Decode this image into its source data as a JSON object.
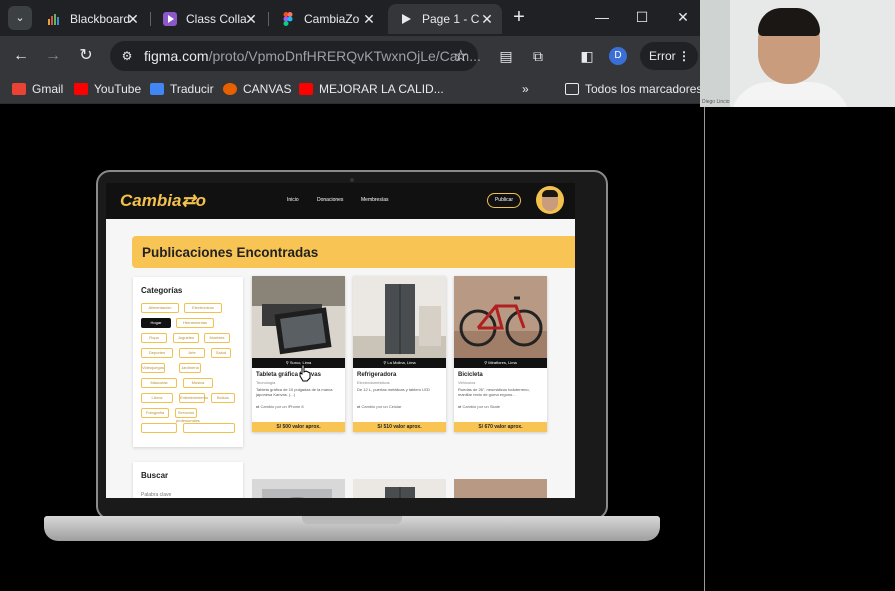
{
  "browser": {
    "tabs": [
      {
        "title": "Blackboard",
        "color": "#e8a33c"
      },
      {
        "title": "Class Colla",
        "color": "#8a58c8"
      },
      {
        "title": "CambiaZo",
        "color": "#f24e1e"
      },
      {
        "title": "Page 1 - C",
        "color": "#e8eaed"
      }
    ],
    "url_host": "figma.com",
    "url_path": "/proto/VpmoDnfHRERQvKTwxnOjLe/Cam...",
    "error_label": "Error",
    "profile_initial": "D",
    "bookmarks": [
      {
        "label": "Gmail",
        "color": "#ea4335"
      },
      {
        "label": "YouTube",
        "color": "#ff0000"
      },
      {
        "label": "Traducir",
        "color": "#4285f4"
      },
      {
        "label": "CANVAS",
        "color": "#e66000"
      },
      {
        "label": "MEJORAR LA CALID...",
        "color": "#ff0000"
      }
    ],
    "all_bookmarks": "Todos los marcadores"
  },
  "webcam": {
    "label": "Diego Lincio"
  },
  "app": {
    "logo": "Cambia⇄o",
    "nav": [
      "Inicio",
      "Donaciones",
      "Membresías"
    ],
    "publish": "Publicar",
    "banner_title": "Publicaciones Encontradas",
    "categories_title": "Categorías",
    "categories": [
      "Alimentación",
      "Electrónicos",
      "Hogar",
      "Herramientas",
      "Ropa",
      "Juguetes",
      "Muebles",
      "Deportes",
      "Arte",
      "Salud",
      "Videojuegos",
      "Jardinería",
      "Mascotas",
      "Música",
      "Libros",
      "Entretenimiento",
      "Bolsos",
      "Fotografía",
      "Servicios profesionales"
    ],
    "search_title": "Buscar",
    "search_placeholder": "Palabra clave",
    "cards": [
      {
        "location": "Surco, Lima",
        "name": "Tableta gráfica Kanvas",
        "category": "Tecnología",
        "desc": "Tableta gráfica de 10 pulgadas de la marca japonesa Kanvas. (...)",
        "exchange": "Cambio por un iPhone 8",
        "price": "S/ 500 valor aprox."
      },
      {
        "location": "La Molina, Lima",
        "name": "Refrigeradora",
        "category": "Electrodomésticos",
        "desc": "De 12 L, puertas metálicas y tablero LED",
        "exchange": "Cambio por un Celular",
        "price": "S/ 510 valor aprox."
      },
      {
        "location": "Miraflores, Lima",
        "name": "Bicicleta",
        "category": "Vehículos",
        "desc": "Ruedas de 26\", neumáticos todoterreno, manillar recto de goma ergono...",
        "exchange": "Cambio por un Skate",
        "price": "S/ 670 valor aprox."
      }
    ]
  }
}
